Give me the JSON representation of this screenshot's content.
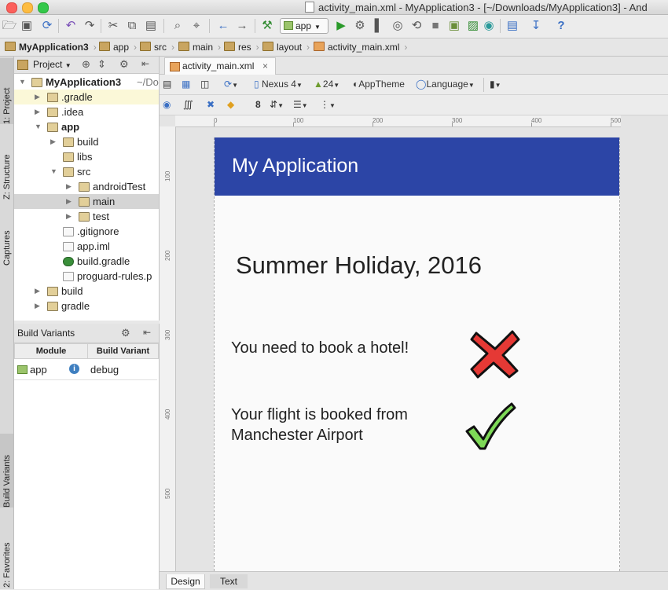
{
  "window": {
    "title": "activity_main.xml - MyApplication3 - [~/Downloads/MyApplication3] - And"
  },
  "toolbar": {
    "run_config": "app"
  },
  "breadcrumb": [
    "MyApplication3",
    "app",
    "src",
    "main",
    "res",
    "layout",
    "activity_main.xml"
  ],
  "left_stripe": {
    "project": "1: Project",
    "structure": "Z: Structure",
    "captures": "Captures",
    "build_variants": "Build Variants",
    "favorites": "2: Favorites"
  },
  "project_panel": {
    "view_selector": "Project",
    "tree": [
      {
        "label": "MyApplication3",
        "suffix": "~/Do",
        "depth": 0,
        "expanded": true,
        "bold": true,
        "icon": "module-icon"
      },
      {
        "label": ".gradle",
        "depth": 1,
        "expanded": false,
        "icon": "folder-icon"
      },
      {
        "label": ".idea",
        "depth": 1,
        "expanded": false,
        "icon": "folder-icon"
      },
      {
        "label": "app",
        "depth": 1,
        "expanded": true,
        "bold": true,
        "icon": "module-icon"
      },
      {
        "label": "build",
        "depth": 2,
        "expanded": false,
        "icon": "folder-icon"
      },
      {
        "label": "libs",
        "depth": 2,
        "icon": "folder-icon"
      },
      {
        "label": "src",
        "depth": 2,
        "expanded": true,
        "icon": "folder-icon"
      },
      {
        "label": "androidTest",
        "depth": 3,
        "expanded": false,
        "icon": "folder-icon"
      },
      {
        "label": "main",
        "depth": 3,
        "expanded": false,
        "icon": "folder-icon",
        "selected": true
      },
      {
        "label": "test",
        "depth": 3,
        "expanded": false,
        "icon": "folder-icon"
      },
      {
        "label": ".gitignore",
        "depth": 2,
        "icon": "file-icon"
      },
      {
        "label": "app.iml",
        "depth": 2,
        "icon": "file-icon"
      },
      {
        "label": "build.gradle",
        "depth": 2,
        "icon": "gradle-icon"
      },
      {
        "label": "proguard-rules.p",
        "depth": 2,
        "icon": "file-icon"
      },
      {
        "label": "build",
        "depth": 1,
        "expanded": false,
        "icon": "folder-icon"
      },
      {
        "label": "gradle",
        "depth": 1,
        "expanded": false,
        "icon": "folder-icon"
      }
    ]
  },
  "build_variants": {
    "title": "Build Variants",
    "columns": [
      "Module",
      "Build Variant"
    ],
    "rows": [
      {
        "module": "app",
        "variant": "debug"
      }
    ]
  },
  "editor": {
    "tab": "activity_main.xml",
    "device": "Nexus 4",
    "api": "24",
    "theme": "AppTheme",
    "language": "Language",
    "margin_value": "8",
    "ruler_top": [
      "0",
      "100",
      "200",
      "300",
      "400",
      "500"
    ],
    "ruler_left": [
      "100",
      "200",
      "300",
      "400",
      "500"
    ],
    "bottom_tabs": [
      "Design",
      "Text"
    ]
  },
  "preview": {
    "app_title": "My Application",
    "heading": "Summer Holiday, 2016",
    "hotel_text": "You need to book a hotel!",
    "flight_text": "Your flight is booked from Manchester Airport",
    "colors": {
      "appbar": "#2c45a6",
      "cross": "#e53935",
      "check": "#7ed957"
    }
  }
}
